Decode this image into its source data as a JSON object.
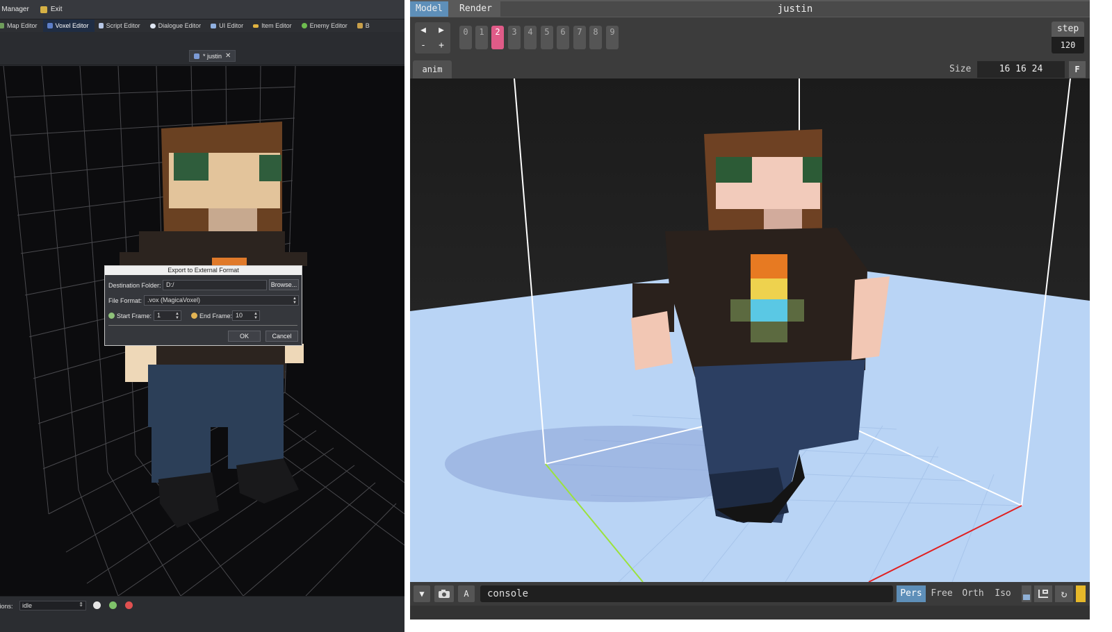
{
  "left_app": {
    "menubar": {
      "manager_label": "e Manager",
      "exit_label": "Exit"
    },
    "tabs": [
      {
        "label": "Map Editor",
        "icon": "map-icon"
      },
      {
        "label": "Voxel Editor",
        "icon": "voxel-icon",
        "active": true
      },
      {
        "label": "Script Editor",
        "icon": "script-icon"
      },
      {
        "label": "Dialogue Editor",
        "icon": "dialogue-icon"
      },
      {
        "label": "UI Editor",
        "icon": "ui-icon"
      },
      {
        "label": "Item Editor",
        "icon": "key-icon"
      },
      {
        "label": "Enemy Editor",
        "icon": "enemy-icon"
      },
      {
        "label": "B",
        "icon": "book-icon"
      }
    ],
    "document_tab": {
      "label": "* justin",
      "close_icon": "close-icon"
    },
    "dialog": {
      "title": "Export to External Format",
      "destination_label": "Destination Folder:",
      "destination_value": "D:/",
      "browse_label": "Browse...",
      "format_label": "File Format:",
      "format_value": ".vox (MagicaVoxel)",
      "start_frame_label": "Start Frame:",
      "start_frame_value": "1",
      "end_frame_label": "End Frame:",
      "end_frame_value": "10",
      "ok_label": "OK",
      "cancel_label": "Cancel"
    },
    "bottom": {
      "animation_label": "tions:",
      "animation_value": "idle"
    },
    "colors": {
      "accent": "#1f2d44",
      "bg": "#2b2d31"
    }
  },
  "right_app": {
    "modes": {
      "model": "Model",
      "render": "Render"
    },
    "title": "justin",
    "frames": [
      "0",
      "1",
      "2",
      "3",
      "4",
      "5",
      "6",
      "7",
      "8",
      "9"
    ],
    "active_frame": "2",
    "nav": {
      "prev": "◀",
      "next": "▶",
      "minus": "-",
      "plus": "+"
    },
    "step": {
      "label": "step",
      "value": "120"
    },
    "anim_tab": "anim",
    "size": {
      "label": "Size",
      "value": "16 16 24",
      "f_button": "F"
    },
    "bottom": {
      "console": "console",
      "a_button": "A",
      "views": [
        "Pers",
        "Free",
        "Orth",
        "Iso"
      ],
      "active_view": "Pers"
    },
    "colors": {
      "accent": "#5e8fb9",
      "active_frame": "#e05b88",
      "floor": "#b9d4f5"
    }
  }
}
